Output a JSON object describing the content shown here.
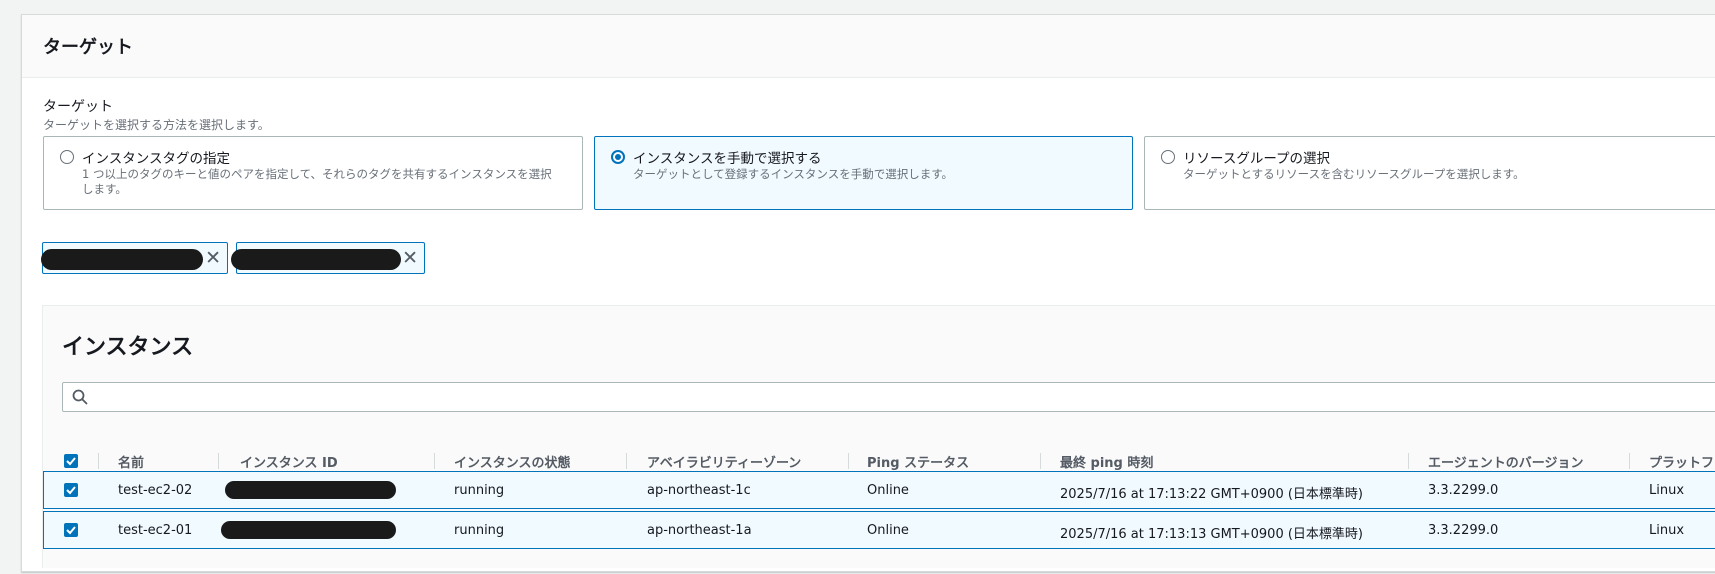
{
  "section": {
    "title": "ターゲット"
  },
  "target_field": {
    "label": "ターゲット",
    "description": "ターゲットを選択する方法を選択します。",
    "options": [
      {
        "title": "インスタンスタグの指定",
        "description": "1 つ以上のタグのキーと値のペアを指定して、それらのタグを共有するインスタンスを選択します。",
        "selected": false
      },
      {
        "title": "インスタンスを手動で選択する",
        "description": "ターゲットとして登録するインスタンスを手動で選択します。",
        "selected": true
      },
      {
        "title": "リソースグループの選択",
        "description": "ターゲットとするリソースを含むリソースグループを選択します。",
        "selected": false
      }
    ]
  },
  "tokens": [
    {
      "remove_icon": "close-icon"
    },
    {
      "remove_icon": "close-icon"
    }
  ],
  "instances": {
    "title": "インスタンス",
    "search": {
      "value": "",
      "placeholder": "",
      "icon": "search-icon"
    },
    "columns": [
      "名前",
      "インスタンス ID",
      "インスタンスの状態",
      "アベイラビリティーゾーン",
      "Ping ステータス",
      "最終 ping 時刻",
      "エージェントのバージョン",
      "プラットフ"
    ],
    "header_checked": true,
    "rows": [
      {
        "checked": true,
        "name": "test-ec2-02",
        "state": "running",
        "az": "ap-northeast-1c",
        "ping": "Online",
        "last_ping": "2025/7/16 at 17:13:22 GMT+0900 (日本標準時)",
        "agent": "3.3.2299.0",
        "platform": "Linux"
      },
      {
        "checked": true,
        "name": "test-ec2-01",
        "state": "running",
        "az": "ap-northeast-1a",
        "ping": "Online",
        "last_ping": "2025/7/16 at 17:13:13 GMT+0900 (日本標準時)",
        "agent": "3.3.2299.0",
        "platform": "Linux"
      }
    ]
  },
  "colors": {
    "accent": "#0073bb",
    "selected_bg": "#f1faff",
    "redaction": "#1a1a1a"
  }
}
